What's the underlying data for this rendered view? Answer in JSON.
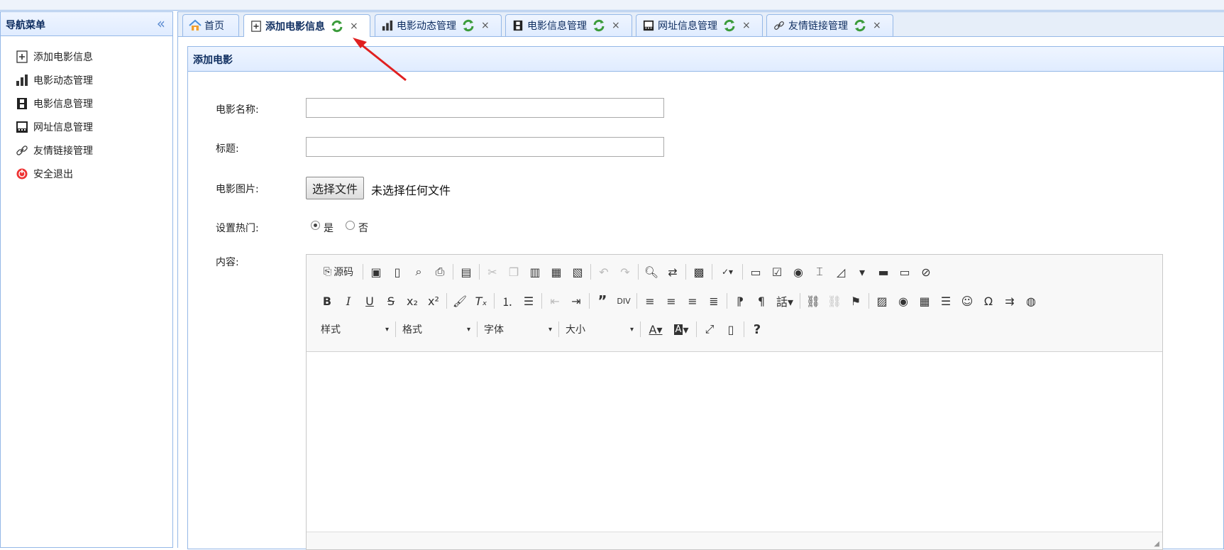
{
  "sidebar": {
    "title": "导航菜单",
    "collapse_icon": "double-chevron-left-icon",
    "items": [
      {
        "label": "添加电影信息",
        "icon": "add-doc-icon"
      },
      {
        "label": "电影动态管理",
        "icon": "bar-chart-icon"
      },
      {
        "label": "电影信息管理",
        "icon": "film-icon"
      },
      {
        "label": "网址信息管理",
        "icon": "monitor-icon"
      },
      {
        "label": "友情链接管理",
        "icon": "link-icon"
      },
      {
        "label": "安全退出",
        "icon": "exit-icon"
      }
    ]
  },
  "tabs": [
    {
      "label": "首页",
      "icon": "home-icon",
      "active": false
    },
    {
      "label": "添加电影信息",
      "icon": "add-doc-icon",
      "active": true
    },
    {
      "label": "电影动态管理",
      "icon": "bar-chart-icon",
      "active": false
    },
    {
      "label": "电影信息管理",
      "icon": "film-icon",
      "active": false
    },
    {
      "label": "网址信息管理",
      "icon": "monitor-icon",
      "active": false
    },
    {
      "label": "友情链接管理",
      "icon": "link-icon",
      "active": false
    }
  ],
  "tab_close": "×",
  "panel": {
    "title": "添加电影"
  },
  "form": {
    "movie_name_label": "电影名称:",
    "movie_name_value": "",
    "title_label": "标题:",
    "title_value": "",
    "image_label": "电影图片:",
    "file_button": "选择文件",
    "file_status": "未选择任何文件",
    "hot_label": "设置热门:",
    "hot_yes": "是",
    "hot_no": "否",
    "hot_selected": "是",
    "content_label": "内容:"
  },
  "editor": {
    "source_label": "源码",
    "combos": [
      "样式",
      "格式",
      "字体",
      "大小"
    ],
    "help": "?"
  },
  "colors": {
    "border": "#95b8e7",
    "header_bg": "#e0ecff",
    "title_text": "#0e2d5f",
    "arrow": "#e02020"
  }
}
